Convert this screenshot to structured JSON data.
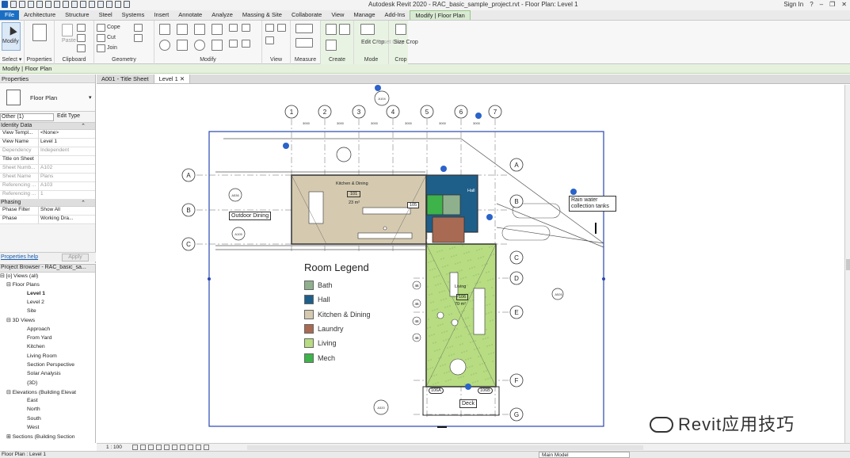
{
  "title_bar": {
    "app_title": "Autodesk Revit 2020 - RAC_basic_sample_project.rvt - Floor Plan: Level 1",
    "sign_in": "Sign In",
    "help": "?"
  },
  "ribbon_tabs": [
    "File",
    "Architecture",
    "Structure",
    "Steel",
    "Systems",
    "Insert",
    "Annotate",
    "Analyze",
    "Massing & Site",
    "Collaborate",
    "View",
    "Manage",
    "Add-Ins",
    "Modify | Floor Plan"
  ],
  "ribbon_groups": {
    "select": "Select ▾",
    "properties": "Properties",
    "clipboard": "Clipboard",
    "geometry": "Geometry",
    "modify": "Modify",
    "view": "View",
    "measure": "Measure",
    "create": "Create",
    "mode": "Mode",
    "crop": "Crop",
    "modify_label": "Modify",
    "paste": "Paste",
    "cope": "Cope",
    "cut": "Cut",
    "join": "Join",
    "edit_crop": "Edit Crop",
    "reset_crop": "Reset Crop",
    "size_crop": "Size Crop"
  },
  "context_bar": "Modify | Floor Plan",
  "properties": {
    "header": "Properties",
    "type_name": "Floor Plan",
    "filter": "Other (1)",
    "edit_type": "Edit Type",
    "sections": [
      {
        "name": "Identity Data",
        "rows": [
          {
            "k": "View Templ...",
            "v": "<None>",
            "dim": false
          },
          {
            "k": "View Name",
            "v": "Level 1",
            "dim": false
          },
          {
            "k": "Dependency",
            "v": "Independent",
            "dim": true
          },
          {
            "k": "Title on Sheet",
            "v": "",
            "dim": false
          },
          {
            "k": "Sheet Numb...",
            "v": "A102",
            "dim": true
          },
          {
            "k": "Sheet Name",
            "v": "Plans",
            "dim": true
          },
          {
            "k": "Referencing ...",
            "v": "A103",
            "dim": true
          },
          {
            "k": "Referencing ...",
            "v": "1",
            "dim": true
          }
        ]
      },
      {
        "name": "Phasing",
        "rows": [
          {
            "k": "Phase Filter",
            "v": "Show All",
            "dim": false
          },
          {
            "k": "Phase",
            "v": "Working Dra...",
            "dim": false
          }
        ]
      }
    ],
    "help_link": "Properties help",
    "apply": "Apply"
  },
  "browser": {
    "header": "Project Browser - RAC_basic_sa...",
    "items": [
      {
        "label": "⊟ [o] Views (all)",
        "indent": 0,
        "sel": false
      },
      {
        "label": "⊟ Floor Plans",
        "indent": 8,
        "sel": false
      },
      {
        "label": "Level 1",
        "indent": 34,
        "sel": true
      },
      {
        "label": "Level 2",
        "indent": 34,
        "sel": false
      },
      {
        "label": "Site",
        "indent": 34,
        "sel": false
      },
      {
        "label": "⊟ 3D Views",
        "indent": 8,
        "sel": false
      },
      {
        "label": "Approach",
        "indent": 34,
        "sel": false
      },
      {
        "label": "From Yard",
        "indent": 34,
        "sel": false
      },
      {
        "label": "Kitchen",
        "indent": 34,
        "sel": false
      },
      {
        "label": "Living Room",
        "indent": 34,
        "sel": false
      },
      {
        "label": "Section Perspective",
        "indent": 34,
        "sel": false
      },
      {
        "label": "Solar Analysis",
        "indent": 34,
        "sel": false
      },
      {
        "label": "{3D}",
        "indent": 34,
        "sel": false
      },
      {
        "label": "⊟ Elevations (Building Elevat",
        "indent": 8,
        "sel": false
      },
      {
        "label": "East",
        "indent": 34,
        "sel": false
      },
      {
        "label": "North",
        "indent": 34,
        "sel": false
      },
      {
        "label": "South",
        "indent": 34,
        "sel": false
      },
      {
        "label": "West",
        "indent": 34,
        "sel": false
      },
      {
        "label": "⊞ Sections (Building Section",
        "indent": 8,
        "sel": false
      }
    ]
  },
  "view_tabs": [
    {
      "label": "A001 - Title Sheet",
      "active": false
    },
    {
      "label": "Level 1",
      "active": true
    }
  ],
  "drawing": {
    "grid_top": [
      "1",
      "2",
      "3",
      "4",
      "5",
      "6",
      "7"
    ],
    "grid_left": [
      "A",
      "B",
      "C"
    ],
    "grid_right": [
      "A",
      "B",
      "C",
      "D",
      "E",
      "F",
      "G"
    ],
    "outdoor_dining": "Outdoor Dining",
    "rain_water": "Rain water collection tanks",
    "deck": "Deck",
    "kitchen_tag": "Kitchen & Dining",
    "kitchen_num": "101",
    "kitchen_area": "23 m²",
    "living_tag": "Living",
    "living_num": "106",
    "living_area": "70 m²",
    "hall_tag": "Hall",
    "dim_label": "3000",
    "tag_105": "105",
    "tag_106a": "106A",
    "tag_106b": "106B",
    "sec_a536": "A536",
    "sec_a105": "A105",
    "sec_a526": "A526",
    "sec_a320": "A320",
    "sec_a104": "A104",
    "door_tag": "46"
  },
  "legend": {
    "title": "Room Legend",
    "items": [
      {
        "label": "Bath",
        "color": "#8fb08c"
      },
      {
        "label": "Hall",
        "color": "#1e5f8a"
      },
      {
        "label": "Kitchen & Dining",
        "color": "#d5cab0"
      },
      {
        "label": "Laundry",
        "color": "#a86a52"
      },
      {
        "label": "Living",
        "color": "#b7dc82"
      },
      {
        "label": "Mech",
        "color": "#3db34a"
      }
    ]
  },
  "view_bar": {
    "scale": "1 : 100"
  },
  "status_bar": {
    "text": "Floor Plan : Level 1",
    "model": "Main Model"
  },
  "watermark": "Revit应用技巧"
}
